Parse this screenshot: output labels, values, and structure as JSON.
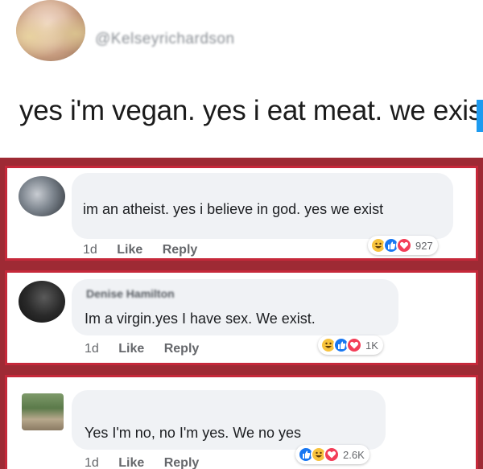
{
  "tweet": {
    "handle": "@Kelseyrichardson",
    "text": "yes i'm vegan. yes i eat meat. we exist."
  },
  "comments": [
    {
      "name": "",
      "text": "im an atheist.  yes i believe in god.  yes we exist",
      "time": "1d",
      "like": "Like",
      "reply": "Reply",
      "reactions": [
        "haha-icon",
        "like-icon",
        "love-icon"
      ],
      "count": "927"
    },
    {
      "name": "Denise Hamilton",
      "text": "Im a virgin.yes I have sex. We exist.",
      "time": "1d",
      "like": "Like",
      "reply": "Reply",
      "reactions": [
        "haha-icon",
        "like-icon",
        "love-icon"
      ],
      "count": "1K"
    },
    {
      "name": "",
      "text": "Yes I'm no, no I'm yes. We no yes",
      "time": "1d",
      "like": "Like",
      "reply": "Reply",
      "reactions": [
        "like-icon",
        "haha-icon",
        "love-icon"
      ],
      "count": "2.6K"
    }
  ],
  "colors": {
    "frame": "#c6283a",
    "bubble": "#f0f2f5",
    "like": "#1877f2",
    "love": "#f33e58",
    "haha": "#f7c23c"
  }
}
